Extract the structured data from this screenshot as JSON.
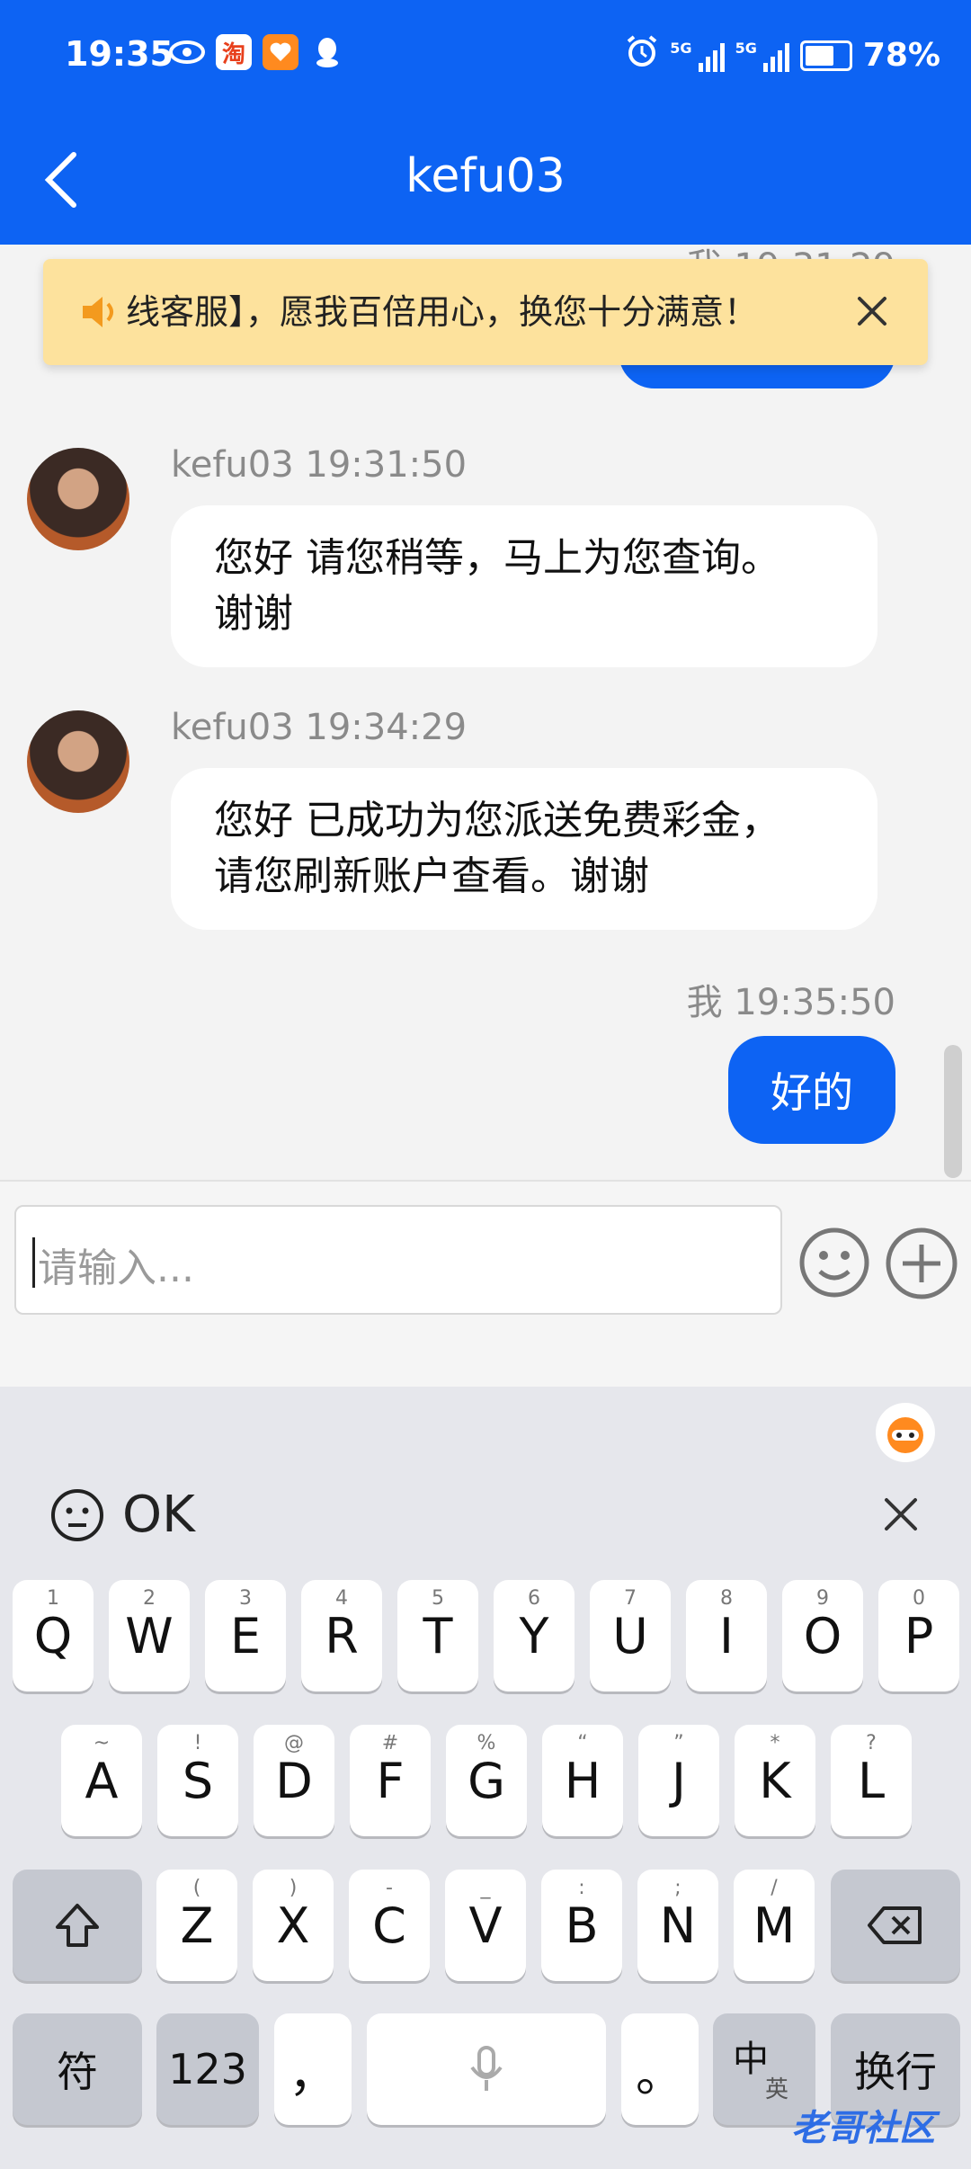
{
  "status_bar": {
    "time": "19:35",
    "battery": "78%",
    "battery_level": 0.78,
    "network_1": "5G",
    "network_2": "5G"
  },
  "header": {
    "title": "kefu03"
  },
  "notice": {
    "text": "线客服】，愿我百倍用心，换您十分满意！"
  },
  "messages": [
    {
      "sender": "我",
      "time": "19:31:29",
      "meta": "我 19:31:29",
      "partial": true
    },
    {
      "sender": "kefu03",
      "time": "19:31:50",
      "meta": "kefu03 19:31:50",
      "text_line1": "您好 请您稍等，马上为您查询。",
      "text_line2": "谢谢"
    },
    {
      "sender": "kefu03",
      "time": "19:34:29",
      "meta": "kefu03 19:34:29",
      "text_line1": "您好 已成功为您派送免费彩金，",
      "text_line2": "请您刷新账户查看。谢谢"
    },
    {
      "sender": "我",
      "time": "19:35:50",
      "meta": "我 19:35:50",
      "text": "好的"
    }
  ],
  "input": {
    "placeholder": "请输入..."
  },
  "keyboard": {
    "suggestion": "OK",
    "row1": [
      {
        "k": "Q",
        "s": "1"
      },
      {
        "k": "W",
        "s": "2"
      },
      {
        "k": "E",
        "s": "3"
      },
      {
        "k": "R",
        "s": "4"
      },
      {
        "k": "T",
        "s": "5"
      },
      {
        "k": "Y",
        "s": "6"
      },
      {
        "k": "U",
        "s": "7"
      },
      {
        "k": "I",
        "s": "8"
      },
      {
        "k": "O",
        "s": "9"
      },
      {
        "k": "P",
        "s": "0"
      }
    ],
    "row2": [
      {
        "k": "A",
        "s": "~"
      },
      {
        "k": "S",
        "s": "!"
      },
      {
        "k": "D",
        "s": "@"
      },
      {
        "k": "F",
        "s": "#"
      },
      {
        "k": "G",
        "s": "%"
      },
      {
        "k": "H",
        "s": "“"
      },
      {
        "k": "J",
        "s": "”"
      },
      {
        "k": "K",
        "s": "*"
      },
      {
        "k": "L",
        "s": "?"
      }
    ],
    "row3": [
      {
        "k": "Z",
        "s": "("
      },
      {
        "k": "X",
        "s": ")"
      },
      {
        "k": "C",
        "s": "-"
      },
      {
        "k": "V",
        "s": "_"
      },
      {
        "k": "B",
        "s": ":"
      },
      {
        "k": "N",
        "s": ";"
      },
      {
        "k": "M",
        "s": "/"
      }
    ],
    "symbol_key": "符",
    "num_key": "123",
    "comma_key": "，",
    "period_key": "。",
    "lang_key": "中",
    "lang_sub": "英",
    "enter_key": "换行"
  },
  "watermark": "老哥社区"
}
